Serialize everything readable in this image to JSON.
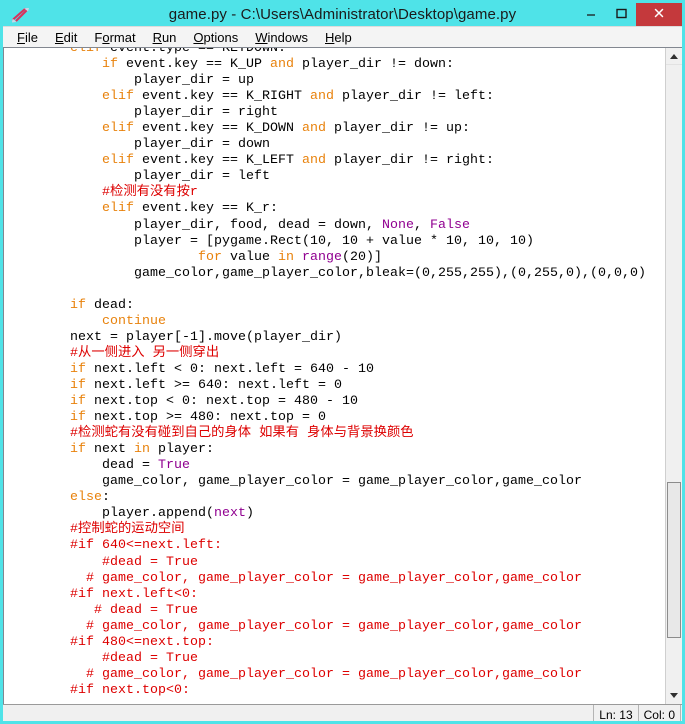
{
  "window": {
    "title": "game.py - C:\\Users\\Administrator\\Desktop\\game.py",
    "icon": "python-idle-icon",
    "minimize_label": "–",
    "maximize_label": "❒",
    "close_label": "✕"
  },
  "menubar": {
    "items": [
      {
        "label": "File",
        "mnemonic": "F"
      },
      {
        "label": "Edit",
        "mnemonic": "E"
      },
      {
        "label": "Format",
        "mnemonic": "o"
      },
      {
        "label": "Run",
        "mnemonic": "R"
      },
      {
        "label": "Options",
        "mnemonic": "O"
      },
      {
        "label": "Windows",
        "mnemonic": "W"
      },
      {
        "label": "Help",
        "mnemonic": "H"
      }
    ]
  },
  "editor": {
    "language": "python",
    "lines": [
      [
        {
          "t": "        ",
          "c": "plain"
        },
        {
          "t": "elif",
          "c": "kw"
        },
        {
          "t": " event.type == KEYDOWN:",
          "c": "plain"
        }
      ],
      [
        {
          "t": "            ",
          "c": "plain"
        },
        {
          "t": "if",
          "c": "kw"
        },
        {
          "t": " event.key == K_UP ",
          "c": "plain"
        },
        {
          "t": "and",
          "c": "kw"
        },
        {
          "t": " player_dir != down:",
          "c": "plain"
        }
      ],
      [
        {
          "t": "                player_dir = up",
          "c": "plain"
        }
      ],
      [
        {
          "t": "            ",
          "c": "plain"
        },
        {
          "t": "elif",
          "c": "kw"
        },
        {
          "t": " event.key == K_RIGHT ",
          "c": "plain"
        },
        {
          "t": "and",
          "c": "kw"
        },
        {
          "t": " player_dir != left:",
          "c": "plain"
        }
      ],
      [
        {
          "t": "                player_dir = right",
          "c": "plain"
        }
      ],
      [
        {
          "t": "            ",
          "c": "plain"
        },
        {
          "t": "elif",
          "c": "kw"
        },
        {
          "t": " event.key == K_DOWN ",
          "c": "plain"
        },
        {
          "t": "and",
          "c": "kw"
        },
        {
          "t": " player_dir != up:",
          "c": "plain"
        }
      ],
      [
        {
          "t": "                player_dir = down",
          "c": "plain"
        }
      ],
      [
        {
          "t": "            ",
          "c": "plain"
        },
        {
          "t": "elif",
          "c": "kw"
        },
        {
          "t": " event.key == K_LEFT ",
          "c": "plain"
        },
        {
          "t": "and",
          "c": "kw"
        },
        {
          "t": " player_dir != right:",
          "c": "plain"
        }
      ],
      [
        {
          "t": "                player_dir = left",
          "c": "plain"
        }
      ],
      [
        {
          "t": "            ",
          "c": "plain"
        },
        {
          "t": "#检测有没有按r",
          "c": "cm"
        }
      ],
      [
        {
          "t": "            ",
          "c": "plain"
        },
        {
          "t": "elif",
          "c": "kw"
        },
        {
          "t": " event.key == K_r:",
          "c": "plain"
        }
      ],
      [
        {
          "t": "                player_dir, food, dead = down, ",
          "c": "plain"
        },
        {
          "t": "None",
          "c": "bi"
        },
        {
          "t": ", ",
          "c": "plain"
        },
        {
          "t": "False",
          "c": "bi"
        }
      ],
      [
        {
          "t": "                player = [pygame.Rect(10, 10 + value * 10, 10, 10)",
          "c": "plain"
        }
      ],
      [
        {
          "t": "                        ",
          "c": "plain"
        },
        {
          "t": "for",
          "c": "kw"
        },
        {
          "t": " value ",
          "c": "plain"
        },
        {
          "t": "in",
          "c": "kw"
        },
        {
          "t": " ",
          "c": "plain"
        },
        {
          "t": "range",
          "c": "bi"
        },
        {
          "t": "(20)]",
          "c": "plain"
        }
      ],
      [
        {
          "t": "                game_color,game_player_color,bleak=(0,255,255),(0,255,0),(0,0,0)",
          "c": "plain"
        }
      ],
      [
        {
          "t": "",
          "c": "plain"
        }
      ],
      [
        {
          "t": "        ",
          "c": "plain"
        },
        {
          "t": "if",
          "c": "kw"
        },
        {
          "t": " dead:",
          "c": "plain"
        }
      ],
      [
        {
          "t": "            ",
          "c": "plain"
        },
        {
          "t": "continue",
          "c": "kw"
        }
      ],
      [
        {
          "t": "        next = player[-1].move(player_dir)",
          "c": "plain"
        }
      ],
      [
        {
          "t": "        ",
          "c": "plain"
        },
        {
          "t": "#从一侧进入 另一侧穿出",
          "c": "cm"
        }
      ],
      [
        {
          "t": "        ",
          "c": "plain"
        },
        {
          "t": "if",
          "c": "kw"
        },
        {
          "t": " next.left < 0: next.left = 640 - 10",
          "c": "plain"
        }
      ],
      [
        {
          "t": "        ",
          "c": "plain"
        },
        {
          "t": "if",
          "c": "kw"
        },
        {
          "t": " next.left >= 640: next.left = 0",
          "c": "plain"
        }
      ],
      [
        {
          "t": "        ",
          "c": "plain"
        },
        {
          "t": "if",
          "c": "kw"
        },
        {
          "t": " next.top < 0: next.top = 480 - 10",
          "c": "plain"
        }
      ],
      [
        {
          "t": "        ",
          "c": "plain"
        },
        {
          "t": "if",
          "c": "kw"
        },
        {
          "t": " next.top >= 480: next.top = 0",
          "c": "plain"
        }
      ],
      [
        {
          "t": "        ",
          "c": "plain"
        },
        {
          "t": "#检测蛇有没有碰到自己的身体 如果有 身体与背景换颜色",
          "c": "cm"
        }
      ],
      [
        {
          "t": "        ",
          "c": "plain"
        },
        {
          "t": "if",
          "c": "kw"
        },
        {
          "t": " next ",
          "c": "plain"
        },
        {
          "t": "in",
          "c": "kw"
        },
        {
          "t": " player:",
          "c": "plain"
        }
      ],
      [
        {
          "t": "            dead = ",
          "c": "plain"
        },
        {
          "t": "True",
          "c": "bi"
        }
      ],
      [
        {
          "t": "            game_color, game_player_color = game_player_color,game_color",
          "c": "plain"
        }
      ],
      [
        {
          "t": "        ",
          "c": "plain"
        },
        {
          "t": "else",
          "c": "kw"
        },
        {
          "t": ":",
          "c": "plain"
        }
      ],
      [
        {
          "t": "            player.append(",
          "c": "plain"
        },
        {
          "t": "next",
          "c": "bi"
        },
        {
          "t": ")",
          "c": "plain"
        }
      ],
      [
        {
          "t": "        ",
          "c": "plain"
        },
        {
          "t": "#控制蛇的运动空间",
          "c": "cm"
        }
      ],
      [
        {
          "t": "        ",
          "c": "plain"
        },
        {
          "t": "#if 640<=next.left:",
          "c": "cm"
        }
      ],
      [
        {
          "t": "            ",
          "c": "plain"
        },
        {
          "t": "#dead = True",
          "c": "cm"
        }
      ],
      [
        {
          "t": "          ",
          "c": "plain"
        },
        {
          "t": "# game_color, game_player_color = game_player_color,game_color",
          "c": "cm"
        }
      ],
      [
        {
          "t": "        ",
          "c": "plain"
        },
        {
          "t": "#if next.left<0:",
          "c": "cm"
        }
      ],
      [
        {
          "t": "           ",
          "c": "plain"
        },
        {
          "t": "# dead = True",
          "c": "cm"
        }
      ],
      [
        {
          "t": "          ",
          "c": "plain"
        },
        {
          "t": "# game_color, game_player_color = game_player_color,game_color",
          "c": "cm"
        }
      ],
      [
        {
          "t": "        ",
          "c": "plain"
        },
        {
          "t": "#if 480<=next.top:",
          "c": "cm"
        }
      ],
      [
        {
          "t": "            ",
          "c": "plain"
        },
        {
          "t": "#dead = True",
          "c": "cm"
        }
      ],
      [
        {
          "t": "          ",
          "c": "plain"
        },
        {
          "t": "# game_color, game_player_color = game_player_color,game_color",
          "c": "cm"
        }
      ],
      [
        {
          "t": "        ",
          "c": "plain"
        },
        {
          "t": "#if next.top<0:",
          "c": "cm"
        }
      ]
    ]
  },
  "scrollbar": {
    "up_arrow": "scroll-up-arrow",
    "down_arrow": "scroll-down-arrow",
    "thumb_top_pct": 67,
    "thumb_height_pct": 25
  },
  "statusbar": {
    "line_label": "Ln: 13",
    "col_label": "Col: 0"
  },
  "colors": {
    "titlebar": "#4fe3e8",
    "close_button": "#c4393c",
    "keyword": "#e8820c",
    "builtin": "#900090",
    "comment": "#dd0000",
    "editor_background": "#ffffff"
  }
}
